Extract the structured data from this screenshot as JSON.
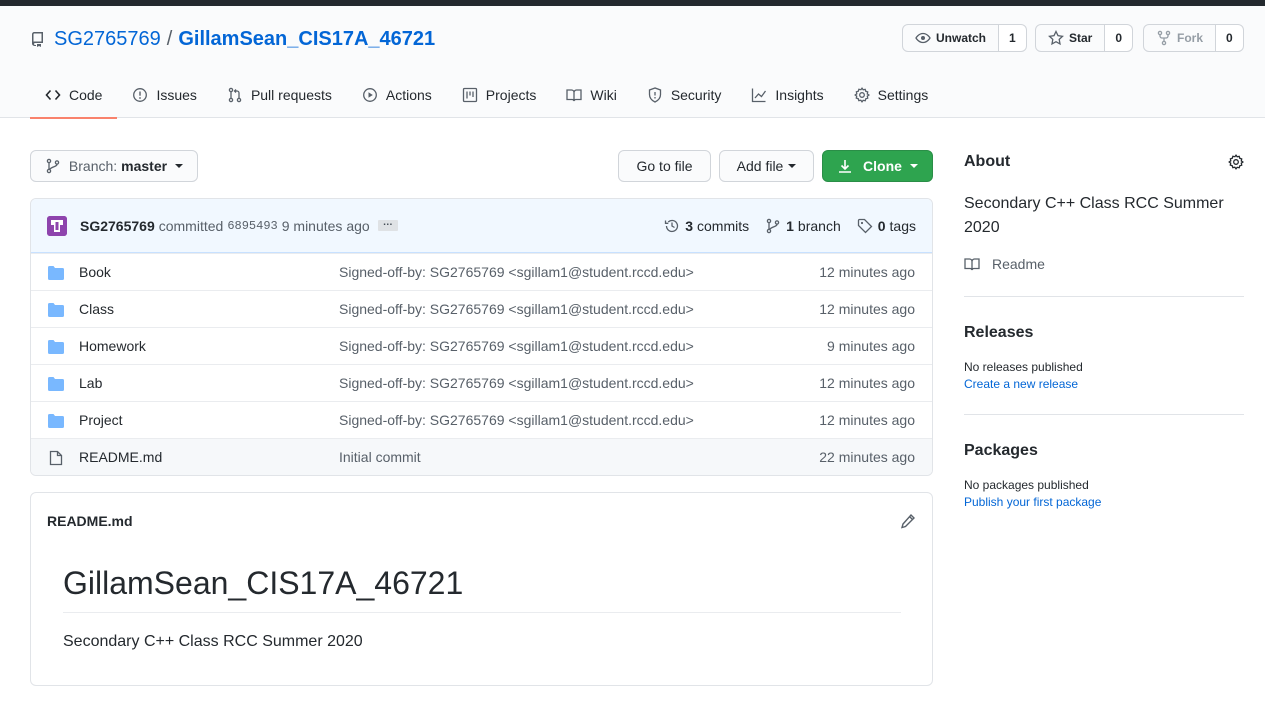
{
  "repo": {
    "owner": "SG2765769",
    "separator": "/",
    "name": "GillamSean_CIS17A_46721"
  },
  "actions": {
    "watch": {
      "label": "Unwatch",
      "count": "1"
    },
    "star": {
      "label": "Star",
      "count": "0"
    },
    "fork": {
      "label": "Fork",
      "count": "0"
    }
  },
  "tabs": [
    {
      "label": "Code",
      "icon": "code-icon"
    },
    {
      "label": "Issues",
      "icon": "issue-icon"
    },
    {
      "label": "Pull requests",
      "icon": "pull-request-icon"
    },
    {
      "label": "Actions",
      "icon": "play-icon"
    },
    {
      "label": "Projects",
      "icon": "project-icon"
    },
    {
      "label": "Wiki",
      "icon": "book-icon"
    },
    {
      "label": "Security",
      "icon": "shield-icon"
    },
    {
      "label": "Insights",
      "icon": "graph-icon"
    },
    {
      "label": "Settings",
      "icon": "gear-icon"
    }
  ],
  "toolbar": {
    "branch_prefix": "Branch:",
    "branch_name": "master",
    "go_to_file": "Go to file",
    "add_file": "Add file",
    "clone": "Clone"
  },
  "commit": {
    "author": "SG2765769",
    "verb": "committed",
    "sha": "6895493",
    "time": "9 minutes ago",
    "ellipsis": "…",
    "commits_count": "3",
    "commits_label": "commits",
    "branch_count": "1",
    "branch_label": "branch",
    "tags_count": "0",
    "tags_label": "tags"
  },
  "files": [
    {
      "name": "Book",
      "type": "folder",
      "message": "Signed-off-by: SG2765769 <sgillam1@student.rccd.edu>",
      "age": "12 minutes ago"
    },
    {
      "name": "Class",
      "type": "folder",
      "message": "Signed-off-by: SG2765769 <sgillam1@student.rccd.edu>",
      "age": "12 minutes ago"
    },
    {
      "name": "Homework",
      "type": "folder",
      "message": "Signed-off-by: SG2765769 <sgillam1@student.rccd.edu>",
      "age": "9 minutes ago"
    },
    {
      "name": "Lab",
      "type": "folder",
      "message": "Signed-off-by: SG2765769 <sgillam1@student.rccd.edu>",
      "age": "12 minutes ago"
    },
    {
      "name": "Project",
      "type": "folder",
      "message": "Signed-off-by: SG2765769 <sgillam1@student.rccd.edu>",
      "age": "12 minutes ago"
    },
    {
      "name": "README.md",
      "type": "file",
      "message": "Initial commit",
      "age": "22 minutes ago"
    }
  ],
  "readme": {
    "filename": "README.md",
    "heading": "GillamSean_CIS17A_46721",
    "body": "Secondary C++ Class RCC Summer 2020"
  },
  "about": {
    "title": "About",
    "description": "Secondary C++ Class RCC Summer 2020",
    "readme_link": "Readme"
  },
  "releases": {
    "title": "Releases",
    "empty": "No releases published",
    "link": "Create a new release"
  },
  "packages": {
    "title": "Packages",
    "empty": "No packages published",
    "link": "Publish your first package"
  },
  "colors": {
    "link": "#0366d6",
    "clone_green": "#2ea44f",
    "tab_underline": "#f9826c",
    "folder": "#79b8ff"
  }
}
